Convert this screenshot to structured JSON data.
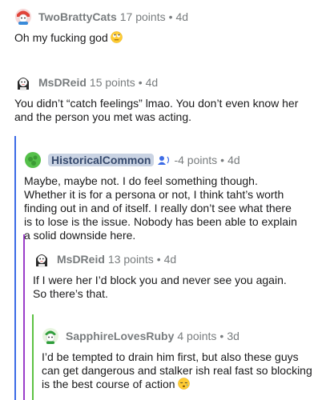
{
  "comments": [
    {
      "username": "TwoBrattyCats",
      "points": "17 points",
      "age": "4d",
      "body": "Oh my fucking god",
      "emoji": "face-with-rolling-eyes"
    },
    {
      "username": "MsDReid",
      "points": "15 points",
      "age": "4d",
      "body": "You didn’t “catch feelings” lmao. You don’t even know her and the person you met was acting."
    },
    {
      "username": "HistoricalCommon",
      "points": "-4 points",
      "age": "4d",
      "body": "Maybe, maybe not. I do feel something though. Whether it is for a persona or not, I think taht’s worth finding out in and of itself. I really don’t see what there is to lose is the issue. Nobody has been able to explain a solid downside here.",
      "badge": "original-poster-icon"
    },
    {
      "username": "MsDReid",
      "points": "13 points",
      "age": "4d",
      "body": "If I were her I’d block you and never see you again. So there’s that."
    },
    {
      "username": "SapphireLovesRuby",
      "points": "4 points",
      "age": "3d",
      "body": "I’d be tempted to drain him first, but also these guys can get dangerous and stalker ish real fast so blocking is the best course of action",
      "emoji": "sleepy-face"
    }
  ],
  "separator": "•",
  "colors": {
    "thread_level_1": "#3d6ce6",
    "thread_level_2": "#9b3ec9",
    "thread_level_3": "#5dc243",
    "meta_gray": "#787c7e",
    "highlight_bg": "#c9d3e3"
  }
}
